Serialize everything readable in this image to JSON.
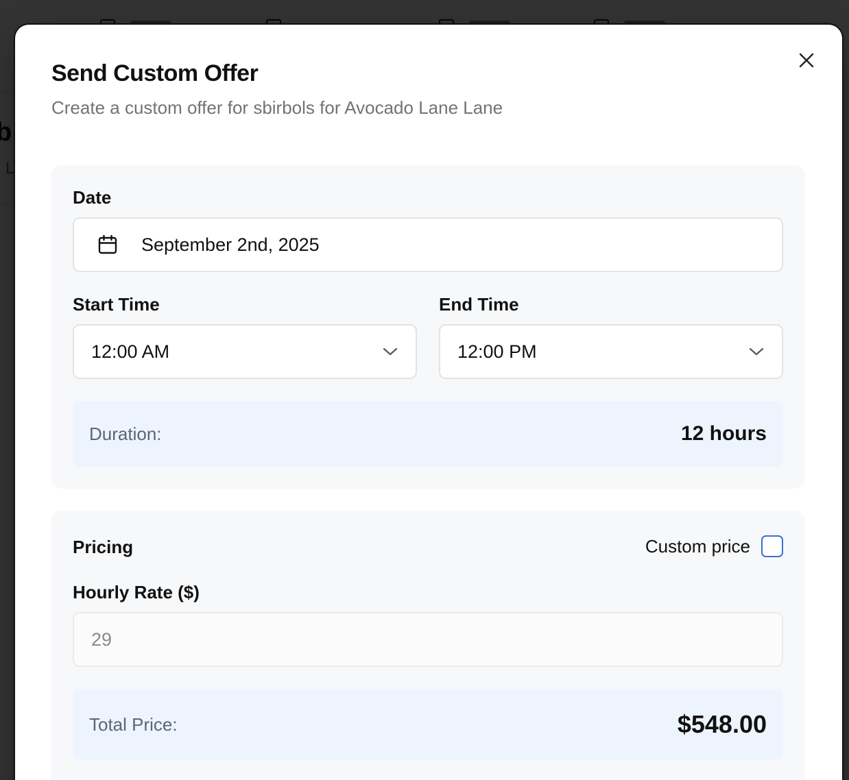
{
  "dialog": {
    "title": "Send Custom Offer",
    "description": "Create a custom offer for sbirbols for Avocado Lane Lane"
  },
  "background": {
    "heading_fragment": "bi",
    "sub_fragment": "L"
  },
  "date": {
    "label": "Date",
    "value": "September 2nd, 2025",
    "icon": "calendar-icon"
  },
  "start_time": {
    "label": "Start Time",
    "value": "12:00 AM"
  },
  "end_time": {
    "label": "End Time",
    "value": "12:00 PM"
  },
  "duration": {
    "label": "Duration:",
    "value": "12 hours"
  },
  "pricing": {
    "label": "Pricing",
    "custom_price_label": "Custom price",
    "custom_price_checked": false,
    "hourly_rate_label": "Hourly Rate ($)",
    "hourly_rate_value": "29",
    "total_label": "Total Price:",
    "total_value": "$548.00"
  },
  "colors": {
    "overlay": "#000000",
    "section_bg": "#f7f8fa",
    "summary_bg": "#eef4fd",
    "checkbox_border": "#3b6fd4"
  }
}
